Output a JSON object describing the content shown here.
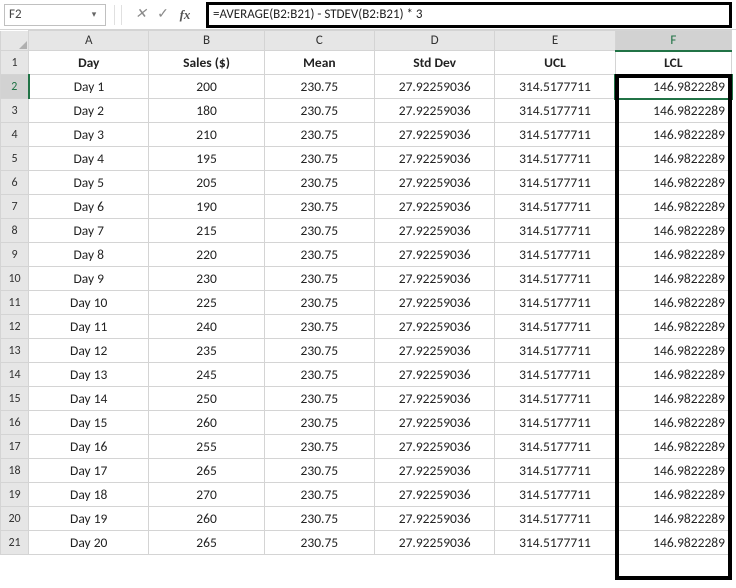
{
  "formula_bar": {
    "cell_ref": "F2",
    "formula": "=AVERAGE(B2:B21) - STDEV(B2:B21) * 3",
    "cancel_glyph": "✕",
    "enter_glyph": "✓",
    "fx_glyph": "fx",
    "dd_glyph": "▾"
  },
  "columns": [
    "A",
    "B",
    "C",
    "D",
    "E",
    "F"
  ],
  "active_col": "F",
  "active_row": 2,
  "header": {
    "A": "Day",
    "B": "Sales ($)",
    "C": "Mean",
    "D": "Std Dev",
    "E": "UCL",
    "F": "LCL"
  },
  "chart_data": {
    "type": "table",
    "columns": [
      "Day",
      "Sales ($)",
      "Mean",
      "Std Dev",
      "UCL",
      "LCL"
    ],
    "rows": [
      {
        "Day": "Day 1",
        "Sales": 200,
        "Mean": 230.75,
        "StdDev": 27.92259036,
        "UCL": 314.5177711,
        "LCL": 146.9822289
      },
      {
        "Day": "Day 2",
        "Sales": 180,
        "Mean": 230.75,
        "StdDev": 27.92259036,
        "UCL": 314.5177711,
        "LCL": 146.9822289
      },
      {
        "Day": "Day 3",
        "Sales": 210,
        "Mean": 230.75,
        "StdDev": 27.92259036,
        "UCL": 314.5177711,
        "LCL": 146.9822289
      },
      {
        "Day": "Day 4",
        "Sales": 195,
        "Mean": 230.75,
        "StdDev": 27.92259036,
        "UCL": 314.5177711,
        "LCL": 146.9822289
      },
      {
        "Day": "Day 5",
        "Sales": 205,
        "Mean": 230.75,
        "StdDev": 27.92259036,
        "UCL": 314.5177711,
        "LCL": 146.9822289
      },
      {
        "Day": "Day 6",
        "Sales": 190,
        "Mean": 230.75,
        "StdDev": 27.92259036,
        "UCL": 314.5177711,
        "LCL": 146.9822289
      },
      {
        "Day": "Day 7",
        "Sales": 215,
        "Mean": 230.75,
        "StdDev": 27.92259036,
        "UCL": 314.5177711,
        "LCL": 146.9822289
      },
      {
        "Day": "Day 8",
        "Sales": 220,
        "Mean": 230.75,
        "StdDev": 27.92259036,
        "UCL": 314.5177711,
        "LCL": 146.9822289
      },
      {
        "Day": "Day 9",
        "Sales": 230,
        "Mean": 230.75,
        "StdDev": 27.92259036,
        "UCL": 314.5177711,
        "LCL": 146.9822289
      },
      {
        "Day": "Day 10",
        "Sales": 225,
        "Mean": 230.75,
        "StdDev": 27.92259036,
        "UCL": 314.5177711,
        "LCL": 146.9822289
      },
      {
        "Day": "Day 11",
        "Sales": 240,
        "Mean": 230.75,
        "StdDev": 27.92259036,
        "UCL": 314.5177711,
        "LCL": 146.9822289
      },
      {
        "Day": "Day 12",
        "Sales": 235,
        "Mean": 230.75,
        "StdDev": 27.92259036,
        "UCL": 314.5177711,
        "LCL": 146.9822289
      },
      {
        "Day": "Day 13",
        "Sales": 245,
        "Mean": 230.75,
        "StdDev": 27.92259036,
        "UCL": 314.5177711,
        "LCL": 146.9822289
      },
      {
        "Day": "Day 14",
        "Sales": 250,
        "Mean": 230.75,
        "StdDev": 27.92259036,
        "UCL": 314.5177711,
        "LCL": 146.9822289
      },
      {
        "Day": "Day 15",
        "Sales": 260,
        "Mean": 230.75,
        "StdDev": 27.92259036,
        "UCL": 314.5177711,
        "LCL": 146.9822289
      },
      {
        "Day": "Day 16",
        "Sales": 255,
        "Mean": 230.75,
        "StdDev": 27.92259036,
        "UCL": 314.5177711,
        "LCL": 146.9822289
      },
      {
        "Day": "Day 17",
        "Sales": 265,
        "Mean": 230.75,
        "StdDev": 27.92259036,
        "UCL": 314.5177711,
        "LCL": 146.9822289
      },
      {
        "Day": "Day 18",
        "Sales": 270,
        "Mean": 230.75,
        "StdDev": 27.92259036,
        "UCL": 314.5177711,
        "LCL": 146.9822289
      },
      {
        "Day": "Day 19",
        "Sales": 260,
        "Mean": 230.75,
        "StdDev": 27.92259036,
        "UCL": 314.5177711,
        "LCL": 146.9822289
      },
      {
        "Day": "Day 20",
        "Sales": 265,
        "Mean": 230.75,
        "StdDev": 27.92259036,
        "UCL": 314.5177711,
        "LCL": 146.9822289
      }
    ]
  }
}
